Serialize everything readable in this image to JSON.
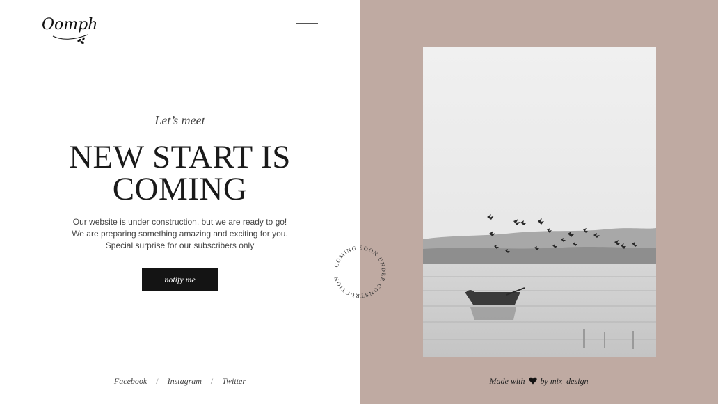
{
  "brand": {
    "logo_text": "Oomph"
  },
  "header": {
    "menu_icon": "hamburger-icon"
  },
  "hero": {
    "tagline": "Let’s meet",
    "headline_line1": "NEW START IS",
    "headline_line2": "COMING",
    "description": [
      "Our website is under construction, but we are ready to go!",
      "We are preparing something amazing and exciting for you.",
      "Special surprise for our subscribers only"
    ],
    "cta_label": "notify me"
  },
  "social": {
    "links": [
      "Facebook",
      "Instagram",
      "Twitter"
    ],
    "separator": "/"
  },
  "badge": {
    "text": "COMING SOON UNDER CONSTRUCTION"
  },
  "footer": {
    "made_with": "Made with",
    "by": "by mix_design",
    "heart_icon": "heart-icon"
  },
  "colors": {
    "panel_background": "#bfaaa2",
    "button_background": "#141414",
    "page_background": "#ffffff"
  }
}
